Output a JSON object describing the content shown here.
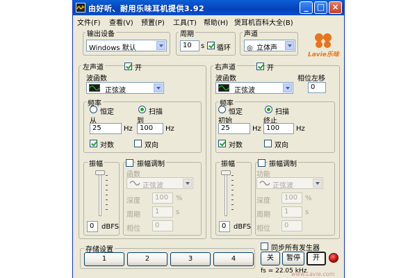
{
  "window": {
    "title": "由好听、耐用乐味耳机提供3.92",
    "minimize_label": "_",
    "maximize_label": "□",
    "close_label": "×"
  },
  "menu": [
    "文件(F)",
    "查看(V)",
    "预置(P)",
    "工具(T)",
    "帮助(H)",
    "煲耳机百科大全(B)"
  ],
  "output": {
    "group_label": "输出设备",
    "device": "Windows 默认",
    "period_label": "周期",
    "period_value": "10",
    "period_unit": "s",
    "loop_label": "循环",
    "loop_checked": true,
    "channel_label": "声道",
    "channel_value": "立体声"
  },
  "logo": {
    "text": "Lavie乐味"
  },
  "left": {
    "title": "左声道",
    "enabled_label": "开",
    "enabled": true,
    "wave_label": "波函数",
    "wave_value": "正弦波",
    "freq_group": "频率",
    "fixed_label": "恒定",
    "sweep_label": "扫描",
    "mode": "sweep",
    "from_label": "从",
    "to_label": "到",
    "from_value": "25",
    "to_value": "100",
    "unit": "Hz",
    "log_label": "对数",
    "log_checked": true,
    "bidir_label": "双向",
    "bidir_checked": false,
    "amp_group": "振幅",
    "amp_value": "0",
    "amp_unit": "dBFS",
    "am_label": "振幅调制",
    "am_checked": false,
    "am_func_label": "函数",
    "am_func_value": "正弦波",
    "am_depth_label": "深度",
    "am_depth_value": "100",
    "am_depth_unit": "%",
    "am_period_label": "周期",
    "am_period_value": "1",
    "am_period_unit": "s",
    "am_phase_label": "相位",
    "am_phase_value": "0"
  },
  "right": {
    "title": "右声道",
    "enabled_label": "开",
    "enabled": true,
    "wave_label": "波函数",
    "wave_value": "正弦波",
    "phase_label": "相位左移",
    "phase_value": "0",
    "freq_group": "频率",
    "fixed_label": "恒定",
    "sweep_label": "扫描",
    "mode": "sweep",
    "from_label": "初始",
    "to_label": "终止",
    "from_value": "25",
    "to_value": "100",
    "unit": "Hz",
    "log_label": "对数",
    "log_checked": true,
    "bidir_label": "双向",
    "bidir_checked": false,
    "amp_group": "振幅",
    "amp_value": "0",
    "amp_unit": "dBFS",
    "am_label": "振幅调制",
    "am_checked": false,
    "am_func_label": "功能",
    "am_func_value": "正弦波",
    "am_depth_label": "深度",
    "am_depth_value": "100",
    "am_depth_unit": "%",
    "am_period_label": "周期",
    "am_period_value": "1",
    "am_period_unit": "s",
    "am_phase_label": "相位",
    "am_phase_value": "0"
  },
  "storage": {
    "group_label": "存储设置",
    "slots": [
      "1",
      "2",
      "3",
      "4"
    ]
  },
  "controls": {
    "sync_label": "同步所有发生器",
    "sync_checked": false,
    "off_label": "关",
    "pause_label": "暂停",
    "on_label": "开",
    "sample_rate": "fs = 22.05 kHz"
  },
  "watermark": "www.Lavie.com",
  "colors": {
    "title_bar": "#0a4fc8",
    "window_bg": "#ece9d8",
    "logo": "#e8741c"
  }
}
